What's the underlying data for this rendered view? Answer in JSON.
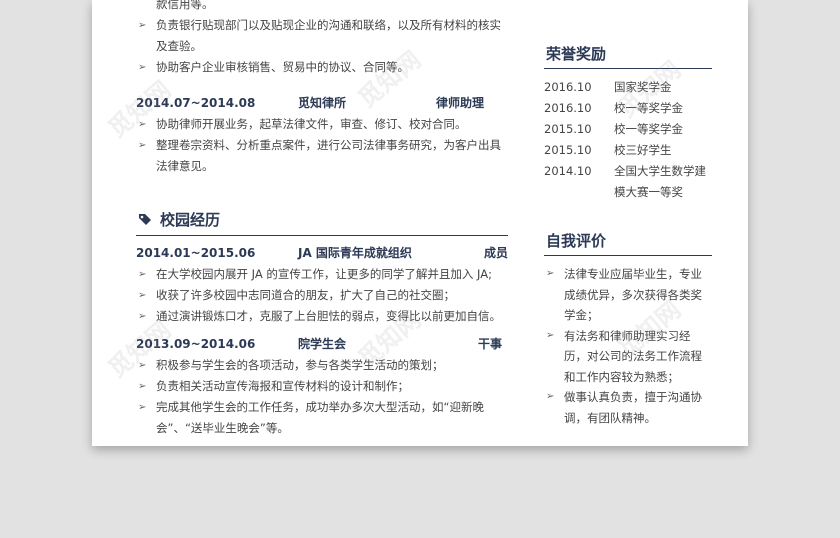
{
  "experience": {
    "prev_bullets": [
      {
        "text": "款信用等。",
        "arrow": false
      },
      {
        "text": "负责银行贴现部门以及贴现企业的沟通和联络，以及所有材料的核实及查验。",
        "arrow": true
      },
      {
        "text": "协助客户企业审核销售、贸易中的协议、合同等。",
        "arrow": true
      }
    ],
    "job": {
      "date": "2014.07~2014.08",
      "org": "觅知律所",
      "role": "律师助理"
    },
    "job_bullets": [
      "协助律师开展业务，起草法律文件，审查、修订、校对合同。",
      "整理卷宗资料、分析重点案件，进行公司法律事务研究，为客户出具法律意见。"
    ]
  },
  "campus": {
    "title": "校园经历",
    "entries": [
      {
        "date": "2014.01~2015.06",
        "org": "JA 国际青年成就组织",
        "role": "成员",
        "bullets": [
          "在大学校园内展开 JA 的宣传工作，让更多的同学了解并且加入 JA;",
          "收获了许多校园中志同道合的朋友，扩大了自己的社交圈；",
          "通过演讲锻炼口才，克服了上台胆怯的弱点，变得比以前更加自信。"
        ]
      },
      {
        "date": "2013.09~2014.06",
        "org": "院学生会",
        "role": "干事",
        "bullets": [
          "积极参与学生会的各项活动，参与各类学生活动的策划；",
          "负责相关活动宣传海报和宣传材料的设计和制作；",
          "完成其他学生会的工作任务，成功举办多次大型活动，如“迎新晚会”、“送毕业生晚会”等。"
        ]
      }
    ]
  },
  "honors": {
    "title": "荣誉奖励",
    "items": [
      {
        "year": "2016.10",
        "name": "国家奖学金"
      },
      {
        "year": "2016.10",
        "name": "校一等奖学金"
      },
      {
        "year": "2015.10",
        "name": "校一等奖学金"
      },
      {
        "year": "2015.10",
        "name": "校三好学生"
      },
      {
        "year": "2014.10",
        "name": "全国大学生数学建模大赛一等奖"
      }
    ]
  },
  "self_eval": {
    "title": "自我评价",
    "bullets": [
      "法律专业应届毕业生，专业成绩优异，多次获得各类奖学金；",
      "有法务和律师助理实习经历，对公司的法务工作流程和工作内容较为熟悉；",
      "做事认真负责，擅于沟通协调，有团队精神。"
    ]
  },
  "watermark": "觅知网",
  "colors": {
    "accent": "#2d3a56",
    "text": "#444444",
    "background": "#e2e2e2"
  }
}
